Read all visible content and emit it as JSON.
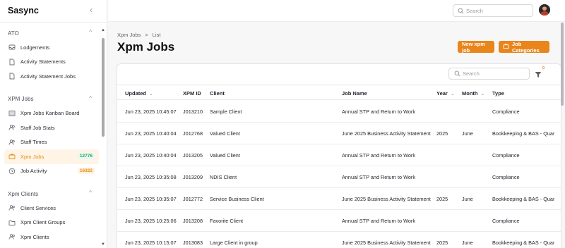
{
  "app": {
    "name": "Sasync"
  },
  "topbar": {
    "search_placeholder": "Search"
  },
  "sidebar": {
    "groups": [
      {
        "label": "ATO",
        "items": [
          {
            "label": "Lodgements",
            "icon": "inbox-icon"
          },
          {
            "label": "Activity Statements",
            "icon": "document-icon"
          },
          {
            "label": "Activity Statement Jobs",
            "icon": "document-icon"
          }
        ]
      },
      {
        "label": "XPM Jobs",
        "items": [
          {
            "label": "Xpm Jobs Kanban Board",
            "icon": "kanban-icon"
          },
          {
            "label": "Staff Job Stats",
            "icon": "users-icon"
          },
          {
            "label": "Staff Times",
            "icon": "clock-icon"
          },
          {
            "label": "Xpm Jobs",
            "icon": "briefcase-icon",
            "badge": "12776",
            "active": true
          },
          {
            "label": "Job Activity",
            "icon": "activity-icon",
            "badge": "16322"
          }
        ]
      },
      {
        "label": "Xpm Clients",
        "items": [
          {
            "label": "Client Services",
            "icon": "users-icon"
          },
          {
            "label": "Xpm Client Groups",
            "icon": "folder-icon"
          },
          {
            "label": "Xpm Clients",
            "icon": "users-icon"
          }
        ]
      }
    ]
  },
  "breadcrumb": {
    "parent": "Xpm Jobs",
    "separator": ">",
    "current": "List"
  },
  "page": {
    "title": "Xpm Jobs"
  },
  "actions": {
    "new_job": "New xpm job",
    "job_categories": "Job Categories"
  },
  "table": {
    "search_placeholder": "Search",
    "filter_count": "0",
    "columns": {
      "updated": "Updated",
      "xpm_id": "XPM ID",
      "client": "Client",
      "job_name": "Job Name",
      "year": "Year",
      "month": "Month",
      "type": "Type"
    },
    "rows": [
      {
        "updated": "Jun 23, 2025 10:45:07",
        "xpm_id": "J013210",
        "client": "Sample Client",
        "job_name": "Annual STP and Return to Work",
        "year": "",
        "month": "",
        "type": "Compliance"
      },
      {
        "updated": "Jun 23, 2025 10:40:04",
        "xpm_id": "J012768",
        "client": "Valued Client",
        "job_name": "June 2025 Business Activity Statement",
        "year": "2025",
        "month": "June",
        "type": "Bookkeeping & BAS - Quarterly"
      },
      {
        "updated": "Jun 23, 2025 10:40:04",
        "xpm_id": "J013205",
        "client": "Valued Client",
        "job_name": "Annual STP and Return to Work",
        "year": "",
        "month": "",
        "type": "Compliance"
      },
      {
        "updated": "Jun 23, 2025 10:35:08",
        "xpm_id": "J013209",
        "client": "NDIS Client",
        "job_name": "Annual STP and Return to Work",
        "year": "",
        "month": "",
        "type": "Compliance"
      },
      {
        "updated": "Jun 23, 2025 10:35:07",
        "xpm_id": "J012772",
        "client": "Service Business Client",
        "job_name": "June 2025 Business Activity Statement",
        "year": "2025",
        "month": "June",
        "type": "Bookkeeping & BAS - Quarterly"
      },
      {
        "updated": "Jun 23, 2025 10:25:06",
        "xpm_id": "J013208",
        "client": "Favorite Client",
        "job_name": "Annual STP and Return to Work",
        "year": "",
        "month": "",
        "type": "Compliance"
      },
      {
        "updated": "Jun 23, 2025 10:15:07",
        "xpm_id": "J013083",
        "client": "Large Client in group",
        "job_name": "June 2025 Business Activity Statement",
        "year": "2025",
        "month": "June",
        "type": "Bookkeeping & BAS - Quarterly"
      }
    ]
  },
  "colors": {
    "accent": "#e9851b",
    "badge_green": "#1ea862",
    "badge_orange": "#e58a0e"
  }
}
